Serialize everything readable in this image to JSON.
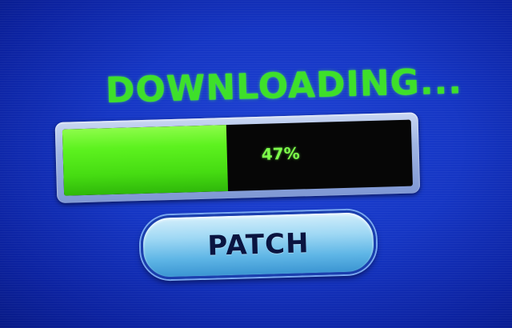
{
  "title": "DOWNLOADING...",
  "progress": {
    "value": 0.47,
    "label": "47%"
  },
  "button": {
    "label": "PATCH"
  },
  "colors": {
    "background": "#1536c4",
    "accent_green": "#3ee02a",
    "track": "#060606",
    "button": "#9fd8f4"
  }
}
